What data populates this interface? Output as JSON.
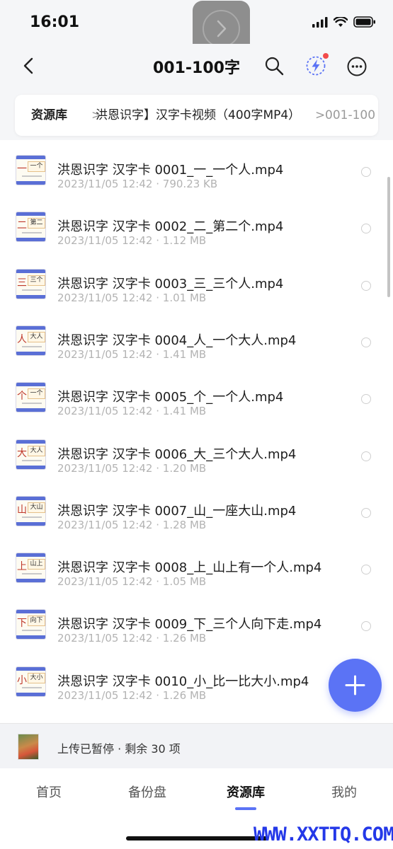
{
  "status_bar": {
    "time": "16:01"
  },
  "nav": {
    "title": "001-100字"
  },
  "breadcrumb": {
    "root": "资源库",
    "separator": ">",
    "middle": "洪恩识字】汉字卡视频（400字MP4）",
    "last": "001-100"
  },
  "files": [
    {
      "name": "洪恩识字 汉字卡 0001_一_一个人.mp4",
      "date": "2023/11/05 12:42",
      "size": "790.23 KB",
      "thumb_char": "一",
      "thumb_word": "一个"
    },
    {
      "name": "洪恩识字 汉字卡 0002_二_第二个.mp4",
      "date": "2023/11/05 12:42",
      "size": "1.12 MB",
      "thumb_char": "二",
      "thumb_word": "第二"
    },
    {
      "name": "洪恩识字 汉字卡 0003_三_三个人.mp4",
      "date": "2023/11/05 12:42",
      "size": "1.01 MB",
      "thumb_char": "三",
      "thumb_word": "三个"
    },
    {
      "name": "洪恩识字 汉字卡 0004_人_一个大人.mp4",
      "date": "2023/11/05 12:42",
      "size": "1.41 MB",
      "thumb_char": "人",
      "thumb_word": "大人"
    },
    {
      "name": "洪恩识字 汉字卡 0005_个_一个人.mp4",
      "date": "2023/11/05 12:42",
      "size": "1.41 MB",
      "thumb_char": "个",
      "thumb_word": "一个"
    },
    {
      "name": "洪恩识字 汉字卡 0006_大_三个大人.mp4",
      "date": "2023/11/05 12:42",
      "size": "1.20 MB",
      "thumb_char": "大",
      "thumb_word": "大人"
    },
    {
      "name": "洪恩识字 汉字卡 0007_山_一座大山.mp4",
      "date": "2023/11/05 12:42",
      "size": "1.28 MB",
      "thumb_char": "山",
      "thumb_word": "大山"
    },
    {
      "name": "洪恩识字 汉字卡 0008_上_山上有一个人.mp4",
      "date": "2023/11/05 12:42",
      "size": "1.05 MB",
      "thumb_char": "上",
      "thumb_word": "山上"
    },
    {
      "name": "洪恩识字 汉字卡 0009_下_三个人向下走.mp4",
      "date": "2023/11/05 12:42",
      "size": "1.26 MB",
      "thumb_char": "下",
      "thumb_word": "向下"
    },
    {
      "name": "洪恩识字 汉字卡 0010_小_比一比大小.mp4",
      "date": "2023/11/05 12:42",
      "size": "1.26 MB",
      "thumb_char": "小",
      "thumb_word": "大小"
    }
  ],
  "meta_separator": "·",
  "upload": {
    "status": "上传已暂停 · 剩余 30 项"
  },
  "tabs": [
    {
      "label": "首页"
    },
    {
      "label": "备份盘"
    },
    {
      "label": "资源库",
      "active": true
    },
    {
      "label": "我的"
    }
  ],
  "watermark": "WWW.XXTTQ.COM",
  "colors": {
    "accent": "#5b73f5",
    "notification_dot": "#f24b4b",
    "watermark": "#2438e8"
  }
}
